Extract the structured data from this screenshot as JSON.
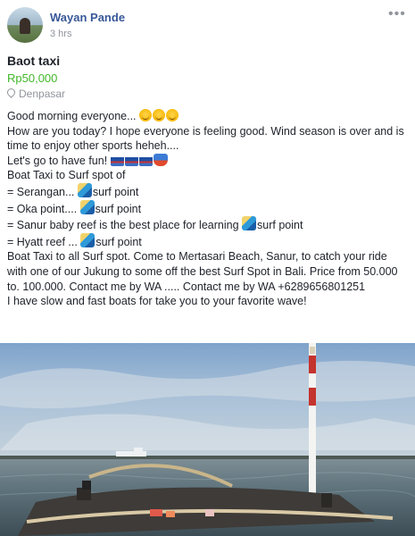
{
  "header": {
    "author": "Wayan Pande",
    "time": "3 hrs",
    "more_label": "•••"
  },
  "listing": {
    "title": "Baot taxi",
    "price": "Rp50,000",
    "location": "Denpasar"
  },
  "body": {
    "line1": "Good morning everyone... ",
    "line2": "How are you today? I hope everyone is feeling good. Wind season is over and is time to enjoy other sports heheh....",
    "line3": "Let's go to have fun! ",
    "line4": "Boat Taxi to Surf spot of",
    "spots": [
      {
        "prefix": "= Serangan... ",
        "suffix": "surf point"
      },
      {
        "prefix": "= Oka point.... ",
        "suffix": "surf point"
      },
      {
        "prefix": "= Sanur baby reef is the best place for learning ",
        "suffix": "surf point"
      },
      {
        "prefix": "= Hyatt reef ... ",
        "suffix": "surf point"
      }
    ],
    "line5": "Boat Taxi to all Surf spot. Come to Mertasari Beach, Sanur, to catch your ride with one of our Jukung to some off the best Surf Spot in Bali. Price from 50.000 to. 100.000. Contact me by WA ..... Contact me by WA +6289656801251",
    "line6": "I have slow and fast boats for take you to your favorite wave!"
  },
  "colors": {
    "author": "#385898",
    "price": "#42b72a",
    "meta": "#90949c"
  },
  "icons": [
    "smile-emoji",
    "ship-emoji",
    "rower-emoji",
    "surfer-emoji",
    "pin-icon",
    "more-icon"
  ]
}
